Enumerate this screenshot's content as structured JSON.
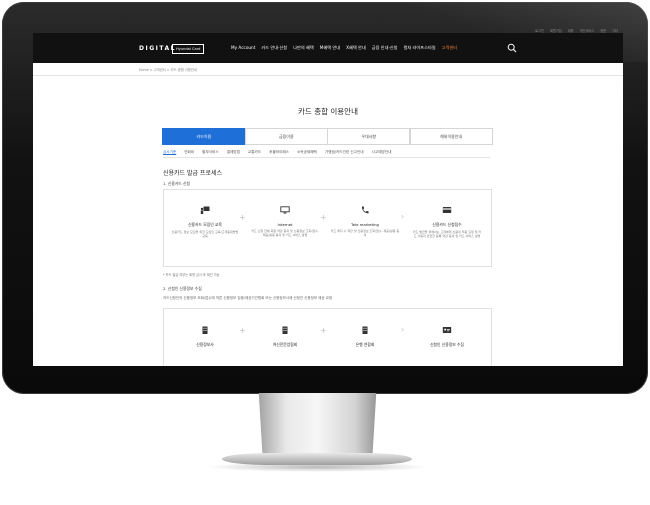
{
  "utility": [
    "로그인",
    "회원가입",
    "제휴",
    "개인서비스",
    "영문",
    "기타"
  ],
  "header": {
    "logo_text": "DIGITAL",
    "logo_box": "Hyundai Card",
    "menu": [
      "My Account",
      "카드 안내·신청",
      "나만의 혜택",
      "M혜택 안내",
      "X혜택 안내",
      "금융 안내·신청",
      "컬처 라이프스타일",
      "고객센터"
    ],
    "highlight_index": 7,
    "accent": "#f4823a"
  },
  "breadcrumb": "Home > 고객센터 > 카드 종합 이용안내",
  "page_title": "카드 종합 이용안내",
  "tabs": [
    "카드이용",
    "금융이용",
    "우대사항",
    "해외이용안내"
  ],
  "active_tab": 0,
  "subtabs": [
    "심사기준",
    "연회비",
    "할부서비스",
    "결제방법",
    "교통카드",
    "후불하이패스",
    "소득공제혜택",
    "가맹점/카드관련 신고안내",
    "사고예방안내"
  ],
  "active_subtab": 0,
  "section_title": "신용카드 발급 프로세스",
  "block1": {
    "heading": "1. 신용카드 신청",
    "steps": [
      {
        "title": "신용카드 모집인 교육",
        "desc": "신용카드 정보 모집을 위한 모집인 교육(고객응대방법 교육",
        "icon": "person-board-icon"
      },
      {
        "title": "Internet",
        "desc": "카드 신청 전에 회원 약관 동의 및 신용정보 조회/접수, 제공/활용 동의 및 카드 서비스 설명",
        "icon": "monitor-icon"
      },
      {
        "title": "Tele marketing",
        "desc": "카드 해지 시 약관 및 신용정보 조회/접수, 제공/활용 동의",
        "icon": "phone-icon"
      },
      {
        "title": "신용카드 신청접수",
        "desc": "카드 발급을 위해서는 고객에게 신용의 적용 요청 및 카드 사용과 관련한 등록 약관 동의 및 카드 서비스 설명",
        "icon": "card-icon"
      }
    ],
    "note": "* 카드 발급 여부는 회원 심사 후 확인 가능"
  },
  "block2": {
    "heading": "2. 신청인 신용정보 수집",
    "desc": "카드신청인의 신용정보 조회/접수에 따른 신용정보 집중/제공기관협회 또는 신용정보사에 신청인 신용정보 제공 요청",
    "steps": [
      {
        "title": "신용정보사",
        "icon": "building-icon"
      },
      {
        "title": "여신전문업협회",
        "icon": "building-icon"
      },
      {
        "title": "은행 연합회",
        "icon": "building-icon"
      },
      {
        "title": "신청인 신용정보 수집",
        "icon": "id-card-icon"
      }
    ]
  }
}
